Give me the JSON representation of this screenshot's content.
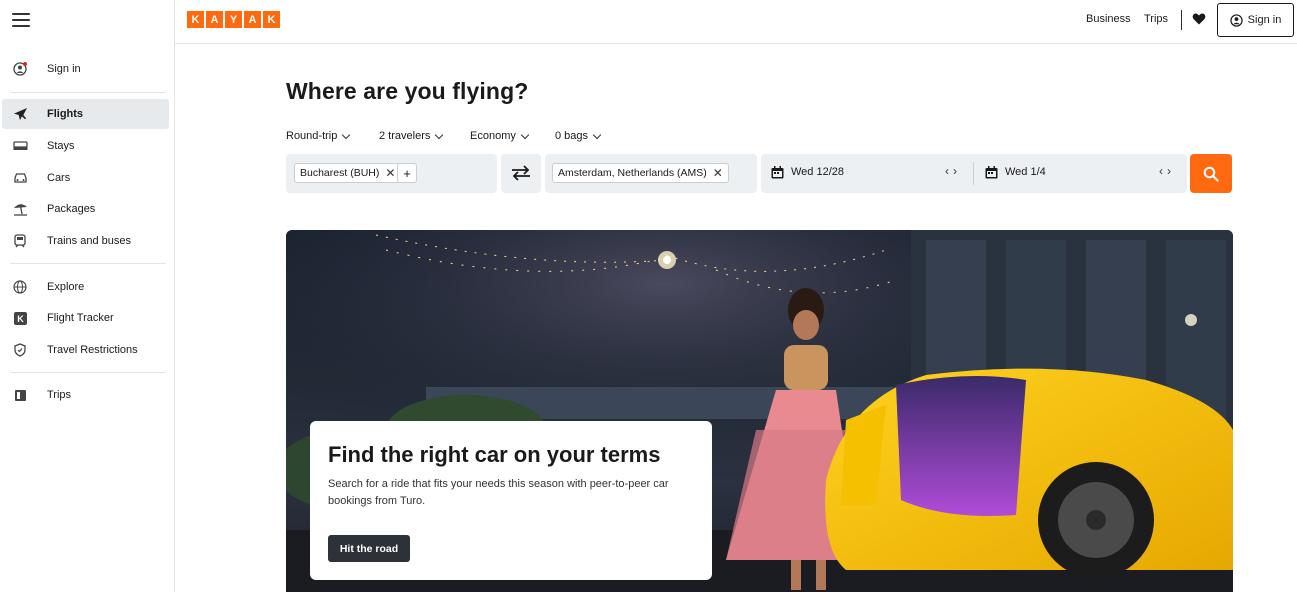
{
  "app": {
    "logo_letters": [
      "K",
      "A",
      "Y",
      "A",
      "K"
    ],
    "brand_color": "#ff690f"
  },
  "sidebar": {
    "signin": "Sign in",
    "items": [
      {
        "label": "Flights",
        "icon": "plane-icon",
        "active": true
      },
      {
        "label": "Stays",
        "icon": "bed-icon"
      },
      {
        "label": "Cars",
        "icon": "car-icon"
      },
      {
        "label": "Packages",
        "icon": "beach-umbrella-icon"
      },
      {
        "label": "Trains and buses",
        "icon": "train-icon"
      }
    ],
    "items2": [
      {
        "label": "Explore",
        "icon": "globe-icon"
      },
      {
        "label": "Flight Tracker",
        "icon": "kayak-k-icon"
      },
      {
        "label": "Travel Restrictions",
        "icon": "shield-icon"
      }
    ],
    "items3": [
      {
        "label": "Trips",
        "icon": "trips-icon"
      }
    ]
  },
  "header": {
    "business": "Business",
    "trips": "Trips",
    "signin": "Sign in"
  },
  "search": {
    "title": "Where are you flying?",
    "trip_type": "Round-trip",
    "travelers": "2 travelers",
    "cabin": "Economy",
    "bags": "0 bags",
    "origin": "Bucharest (BUH)",
    "destination": "Amsterdam, Netherlands (AMS)",
    "depart": "Wed 12/28",
    "return": "Wed 1/4"
  },
  "hero": {
    "title": "Find the right car on your terms",
    "description": "Search for a ride that fits your needs this season with peer-to-peer car bookings from Turo.",
    "cta": "Hit the road"
  }
}
